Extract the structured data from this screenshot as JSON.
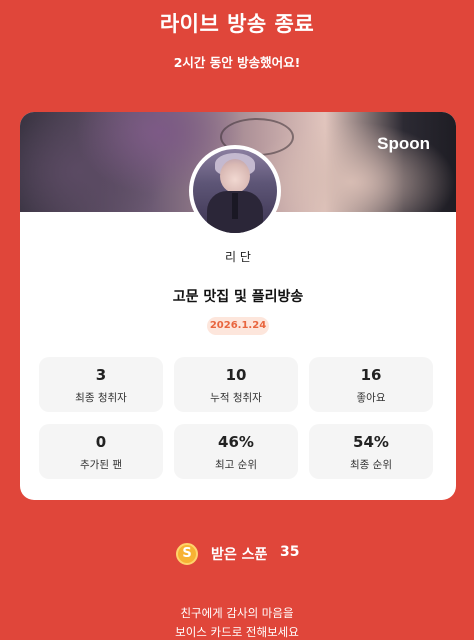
{
  "header": {
    "title": "라이브 방송 종료",
    "subtitle": "2시간 동안 방송했어요!"
  },
  "card": {
    "brand": "Spoon",
    "nickname": "리 단",
    "broadcast_title": "고문 맛집 및 플리방송",
    "date": "2026.1.24",
    "stats": [
      {
        "value": "3",
        "label": "최종 청취자"
      },
      {
        "value": "10",
        "label": "누적 청취자"
      },
      {
        "value": "16",
        "label": "좋아요"
      },
      {
        "value": "0",
        "label": "추가된 팬"
      },
      {
        "value": "46%",
        "label": "최고 순위"
      },
      {
        "value": "54%",
        "label": "최종 순위"
      }
    ]
  },
  "spoons": {
    "icon_letter": "S",
    "label": "받은 스푼",
    "count": "35"
  },
  "footer": {
    "line1": "친구에게 감사의 마음을",
    "line2": "보이스 카드로 전해보세요"
  },
  "colors": {
    "background": "#e0463a",
    "date_badge_bg": "#fde6dc",
    "date_badge_text": "#e8663f",
    "coin": "#f7b233"
  }
}
